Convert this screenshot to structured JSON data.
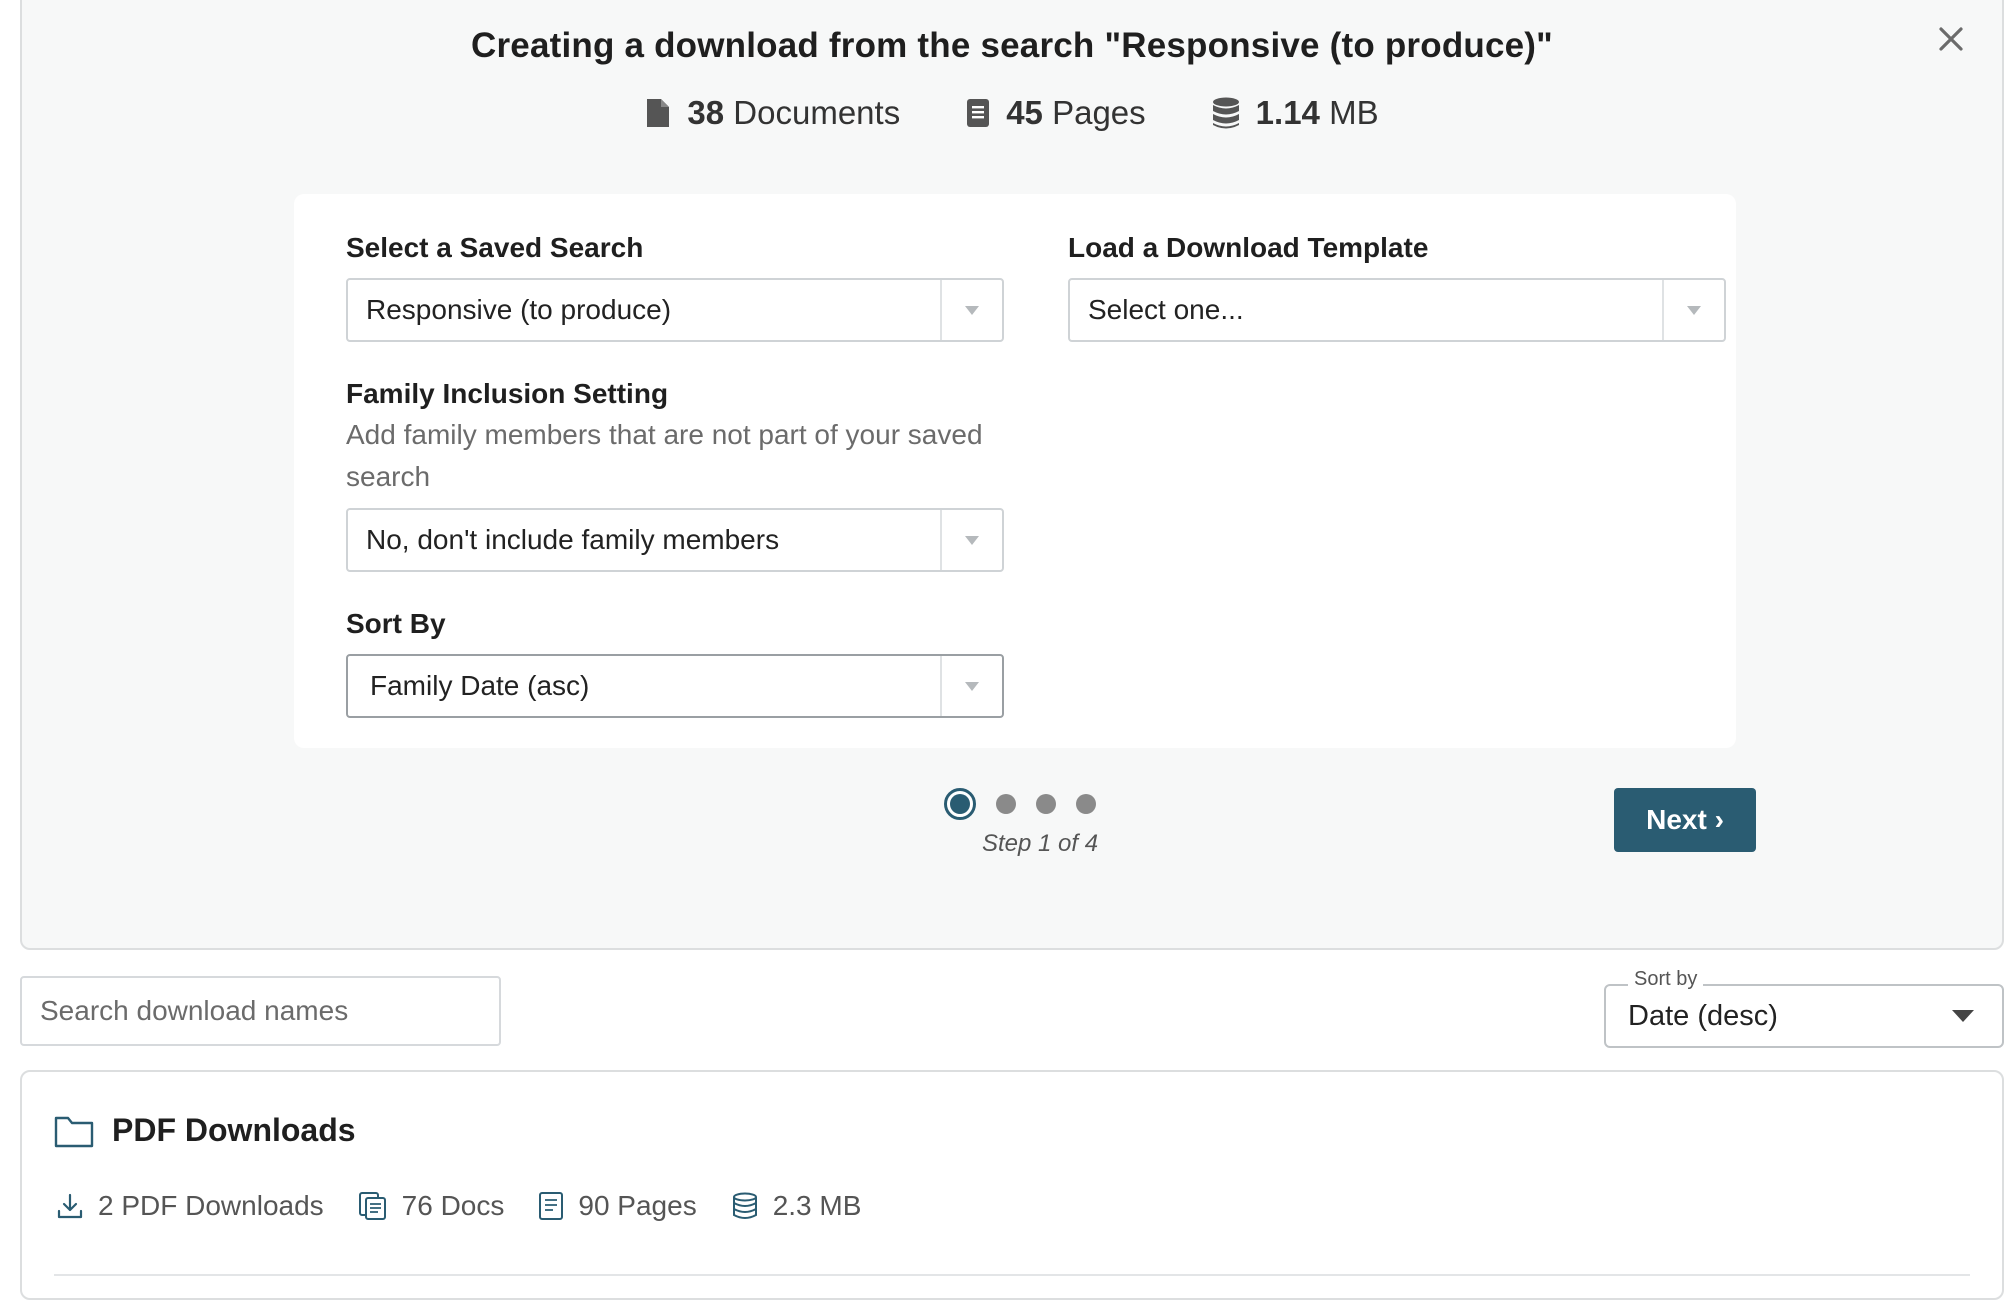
{
  "modal": {
    "title": "Creating a download from the search \"Responsive (to produce)\"",
    "stats": {
      "documents_count": "38",
      "documents_label": "Documents",
      "pages_count": "45",
      "pages_label": "Pages",
      "size_value": "1.14",
      "size_unit": "MB"
    },
    "form": {
      "saved_search": {
        "label": "Select a Saved Search",
        "value": "Responsive (to produce)"
      },
      "download_template": {
        "label": "Load a Download Template",
        "value": "Select one..."
      },
      "family_inclusion": {
        "label": "Family Inclusion Setting",
        "help": "Add family members that are not part of your saved search",
        "value": "No, don't include family members"
      },
      "sort_by": {
        "label": "Sort By",
        "value": "Family Date (asc)"
      }
    },
    "stepper": {
      "current_step": 1,
      "total_steps": 4,
      "text": "Step 1 of 4"
    },
    "next_label": "Next ›"
  },
  "list_controls": {
    "search_placeholder": "Search download names",
    "sort_legend": "Sort by",
    "sort_value": "Date (desc)"
  },
  "downloads_group": {
    "title": "PDF Downloads",
    "downloads": "2 PDF Downloads",
    "docs": "76 Docs",
    "pages": "90 Pages",
    "size": "2.3 MB"
  },
  "colors": {
    "accent": "#2a5c72",
    "panel_bg": "#f7f8f8",
    "inactive_dot": "#8a8a8a"
  }
}
